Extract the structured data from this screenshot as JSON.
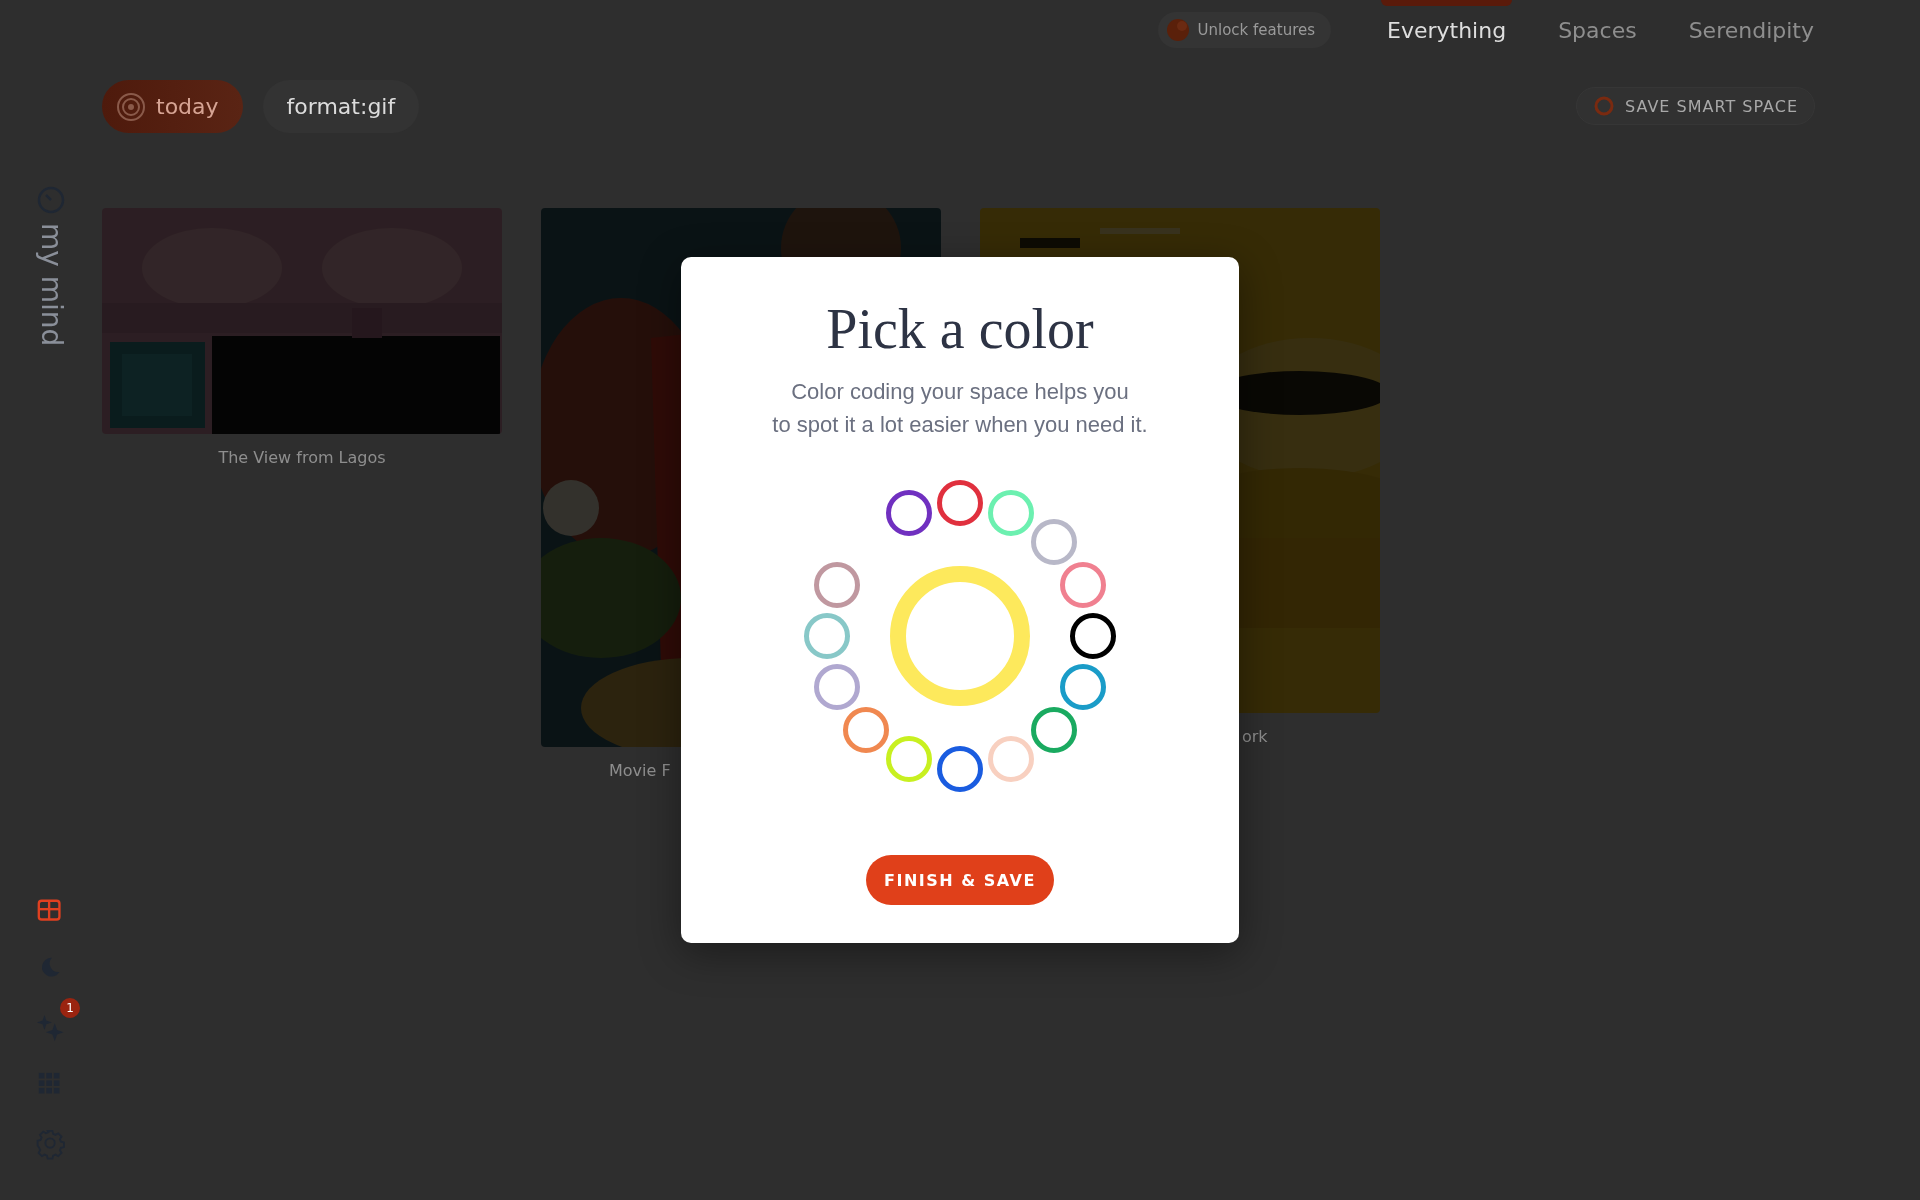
{
  "top_nav": {
    "unlock": {
      "label": "Unlock features"
    },
    "tabs": [
      {
        "label": "Everything",
        "selected": true
      },
      {
        "label": "Spaces",
        "selected": false
      },
      {
        "label": "Serendipity",
        "selected": false
      }
    ]
  },
  "filters": [
    {
      "kind": "date",
      "label": "today"
    },
    {
      "kind": "query",
      "label": "format:gif"
    }
  ],
  "save_button": {
    "label": "SAVE SMART SPACE"
  },
  "sidebar": {
    "title": "my mind",
    "icons": [
      {
        "kind": "gift"
      },
      {
        "kind": "moon"
      },
      {
        "kind": "sparkles",
        "badge": "1"
      },
      {
        "kind": "grid"
      },
      {
        "kind": "settings"
      }
    ]
  },
  "cards": [
    {
      "kind": "picture",
      "caption": "The View from Lagos"
    },
    {
      "kind": "picture",
      "caption": "Movie F"
    },
    {
      "kind": "picture",
      "caption": "ork"
    }
  ],
  "dialog": {
    "title": "Pick a color",
    "description": "Color coding your space helps you\nto spot it a lot easier when you need it.",
    "selected": {
      "color": "#fde95c"
    },
    "colors": [
      {
        "color": "#e0303e"
      },
      {
        "color": "#6cf0b0"
      },
      {
        "color": "#b8b8c8"
      },
      {
        "color": "#f08090"
      },
      {
        "color": "#000000"
      },
      {
        "color": "#1a9cc8"
      },
      {
        "color": "#1aaa60"
      },
      {
        "color": "#f8d0c0"
      },
      {
        "color": "#1a5ce0"
      },
      {
        "color": "#c8f020"
      },
      {
        "color": "#f08850"
      },
      {
        "color": "#b0a8d0"
      },
      {
        "color": "#88c8c8"
      },
      {
        "color": "#c098a0"
      },
      {
        "color": "#7030c0"
      }
    ],
    "button": "FINISH & SAVE"
  }
}
